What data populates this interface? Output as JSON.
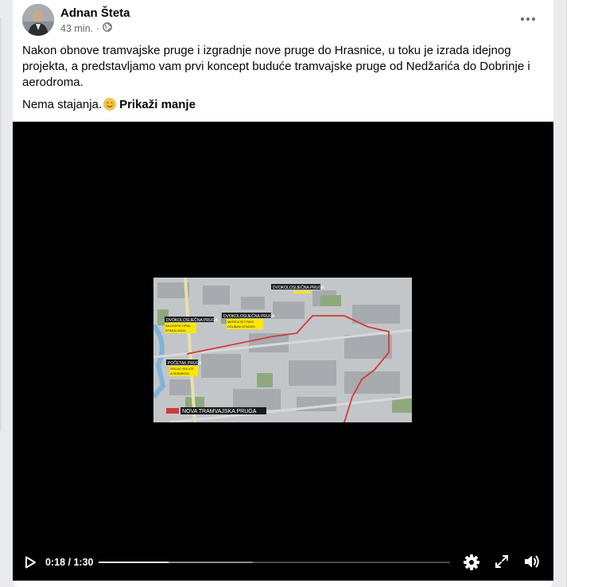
{
  "post": {
    "author": "Adnan Šteta",
    "time": "43 min.",
    "dot": "·",
    "audience_icon": "globe-icon",
    "more_icon": "more-dots-icon",
    "text": "Nakon obnove tramvajske pruge i izgradnje nove pruge do Hrasnice, u toku je izrada idejnog projekta, a predstavljamo vam prvi koncept buduće tramvajske pruge od Nedžarića do Dobrinje i aerodroma.",
    "text2": "Nema stajanja.",
    "emoji": "smiling-face-emoji",
    "see_less": "Prikaži manje"
  },
  "video": {
    "current_time": "0:18",
    "separator": " / ",
    "duration": "1:30",
    "played_fraction": 0.2,
    "buffered_fraction": 0.44,
    "icons": [
      "play-icon",
      "settings-gear-icon",
      "fullscreen-icon",
      "volume-icon"
    ],
    "map_labels": {
      "label_top": "DVOKOLOSIJEČNA PRUGA",
      "label_left": "DVOKOLOSIJEČNA PRUGA",
      "label_left_sub1": "IMLEDŽITA TIPNA",
      "label_left_sub2": "STIMOLOGIJA",
      "label_mid": "DVOKOLOSIJEČNA PRUGA",
      "label_mid_sub1": "MAFIEVITET PAKE",
      "label_mid_sub2": "DOLIBAN OTNOSIS",
      "label_start": "POČETAK PRUGE",
      "label_start_sub1": "SPAJAC ROLICE",
      "label_start_sub2": "A NEDIARIĆA",
      "legend": "NOVA TRAMVAJSKA PRUGA"
    },
    "colors": {
      "route": "#d23a3a",
      "label_bg": "#ffe600",
      "map_bg": "#b9bcbf"
    }
  }
}
